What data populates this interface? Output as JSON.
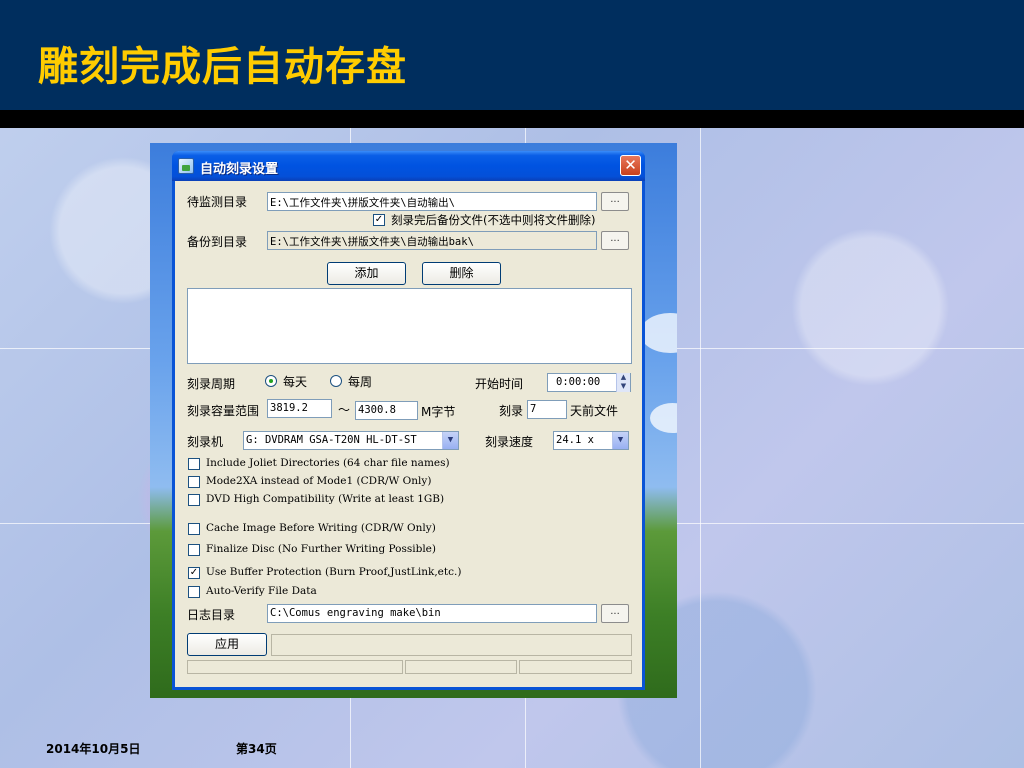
{
  "slide": {
    "title": "雕刻完成后自动存盘",
    "footer_date": "2014年10月5日",
    "footer_page": "第34页"
  },
  "colors": {
    "header_bg": "#002e5e",
    "title_text": "#ffcc00",
    "xp_titlebar": "#0053e1",
    "xp_window_bg": "#ece9d8"
  },
  "window": {
    "title": "自动刻录设置",
    "close_glyph": "✕",
    "icon": "app-icon"
  },
  "form": {
    "watch_dir_label": "待监测目录",
    "watch_dir_value": "E:\\工作文件夹\\拼版文件夹\\自动输出\\",
    "browse_glyph": "...",
    "backup_checkbox_label": "刻录完后备份文件(不选中则将文件删除)",
    "backup_checkbox_checked": true,
    "backup_dir_label": "备份到目录",
    "backup_dir_value": "E:\\工作文件夹\\拼版文件夹\\自动输出bak\\",
    "add_button": "添加",
    "delete_button": "删除",
    "cycle_label": "刻录周期",
    "cycle_daily": "每天",
    "cycle_weekly": "每周",
    "cycle_selected": "daily",
    "start_time_label": "开始时间",
    "start_time_value": "0:00:00",
    "capacity_label": "刻录容量范围",
    "capacity_min": "3819.2",
    "capacity_sep": "～",
    "capacity_max": "4300.8",
    "capacity_unit": "M字节",
    "burn_days_label": "刻录",
    "burn_days_value": "7",
    "burn_days_suffix": "天前文件",
    "burner_label": "刻录机",
    "burner_value": "G: DVDRAM GSA-T20N HL-DT-ST",
    "speed_label": "刻录速度",
    "speed_value": "24.1 x",
    "log_dir_label": "日志目录",
    "log_dir_value": "C:\\Comus engraving make\\bin",
    "apply_button": "应用"
  },
  "options": [
    {
      "label": "Include Joliet Directories (64 char file names)",
      "checked": false
    },
    {
      "label": "Mode2XA instead of Mode1 (CDR/W Only)",
      "checked": false
    },
    {
      "label": "DVD High Compatibility (Write at least 1GB)",
      "checked": false
    },
    {
      "label": "Cache Image Before Writing (CDR/W Only)",
      "checked": false
    },
    {
      "label": "Finalize Disc (No Further Writing Possible)",
      "checked": false
    },
    {
      "label": "Use Buffer Protection (Burn Proof,JustLink,etc.)",
      "checked": true
    },
    {
      "label": "Auto-Verify File Data",
      "checked": false
    }
  ]
}
